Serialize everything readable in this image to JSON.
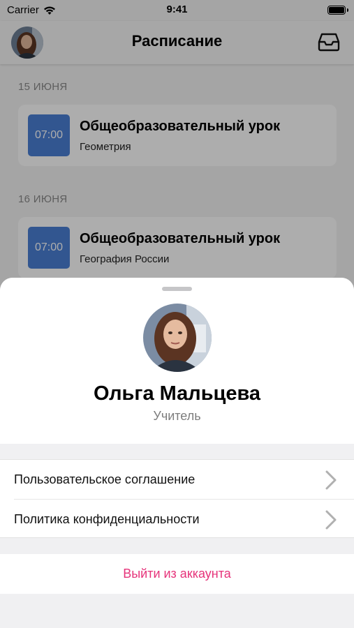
{
  "status_bar": {
    "carrier": "Carrier",
    "time": "9:41"
  },
  "nav": {
    "title": "Расписание",
    "avatar_icon": "user-avatar",
    "inbox_icon": "inbox-icon"
  },
  "schedule": [
    {
      "date": "15 ИЮНЯ",
      "time": "07:00",
      "title": "Общеобразовательный урок",
      "subject": "Геометрия"
    },
    {
      "date": "16 ИЮНЯ",
      "time": "07:00",
      "title": "Общеобразовательный урок",
      "subject": "География России"
    }
  ],
  "profile": {
    "name": "Ольга Мальцева",
    "role": "Учитель"
  },
  "menu": {
    "items": [
      {
        "label": "Пользовательское соглашение"
      },
      {
        "label": "Политика конфиденциальности"
      }
    ],
    "logout_label": "Выйти из аккаунта"
  },
  "colors": {
    "accent_time_badge": "#4a7fd4",
    "logout": "#e6337a",
    "chevron": "#b0b0b0"
  }
}
